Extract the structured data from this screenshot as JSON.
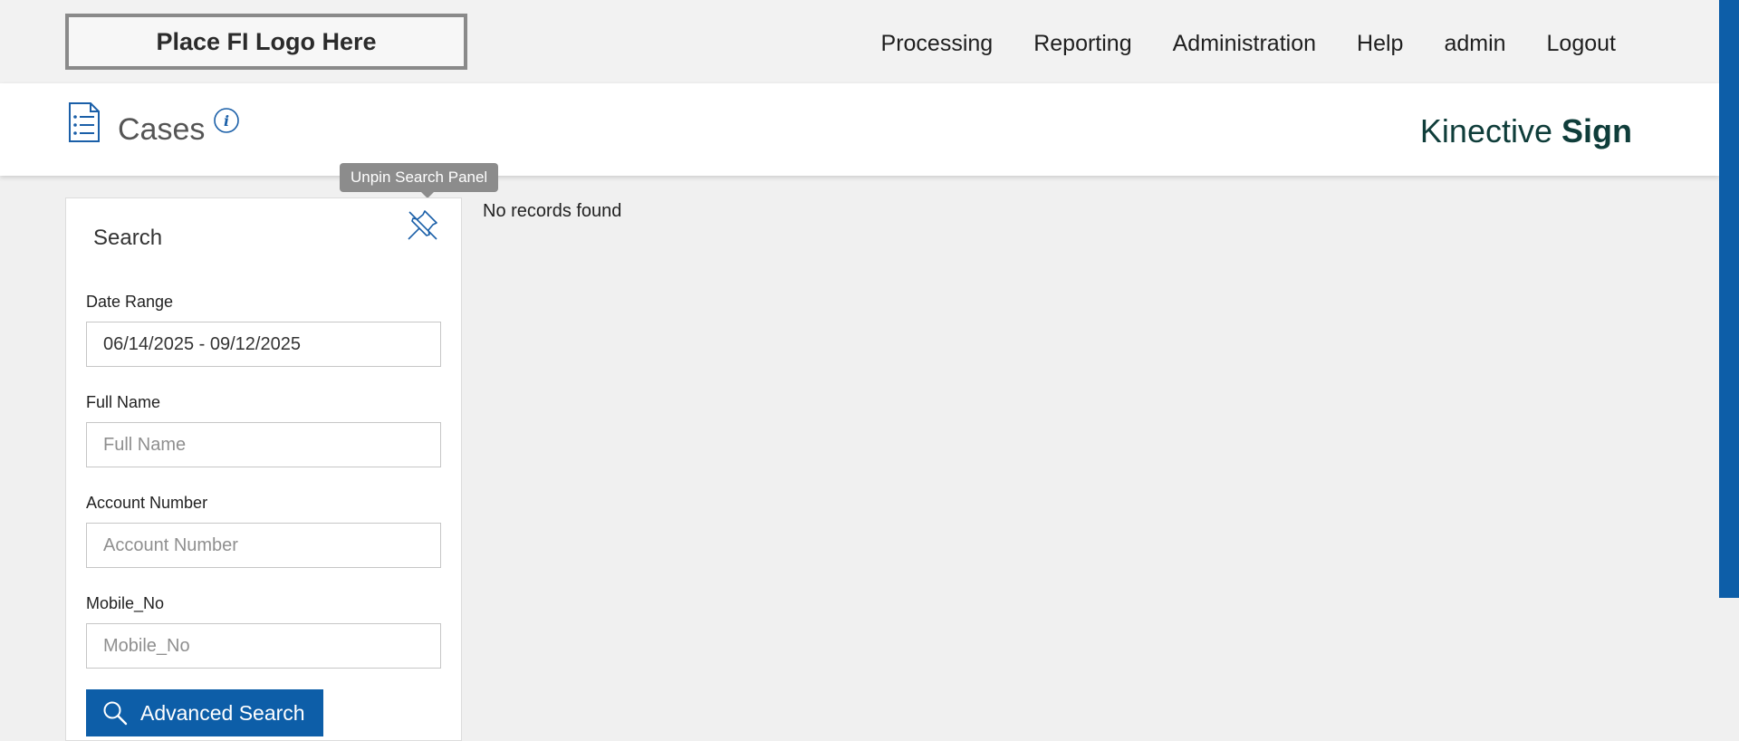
{
  "logo": {
    "text": "Place FI Logo Here"
  },
  "nav": {
    "items": [
      {
        "label": "Processing"
      },
      {
        "label": "Reporting"
      },
      {
        "label": "Administration"
      },
      {
        "label": "Help"
      },
      {
        "label": "admin"
      },
      {
        "label": "Logout"
      }
    ]
  },
  "header": {
    "title": "Cases",
    "brand_light": "Kinective ",
    "brand_bold": "Sign"
  },
  "tooltip": {
    "text": "Unpin Search Panel"
  },
  "search": {
    "title": "Search",
    "fields": [
      {
        "label": "Date Range",
        "value": "06/14/2025 - 09/12/2025",
        "placeholder": ""
      },
      {
        "label": "Full Name",
        "value": "",
        "placeholder": "Full Name"
      },
      {
        "label": "Account Number",
        "value": "",
        "placeholder": "Account Number"
      },
      {
        "label": "Mobile_No",
        "value": "",
        "placeholder": "Mobile_No"
      }
    ],
    "advanced_label": "Advanced Search"
  },
  "results": {
    "empty_text": "No records found"
  },
  "colors": {
    "accent": "#0d5ea8",
    "brand": "#0f3d3a",
    "tooltip_bg": "#8c8c8c"
  },
  "icons": {
    "cases": "list-document-icon",
    "info": "info-icon",
    "pin": "unpin-icon",
    "search": "search-icon"
  }
}
